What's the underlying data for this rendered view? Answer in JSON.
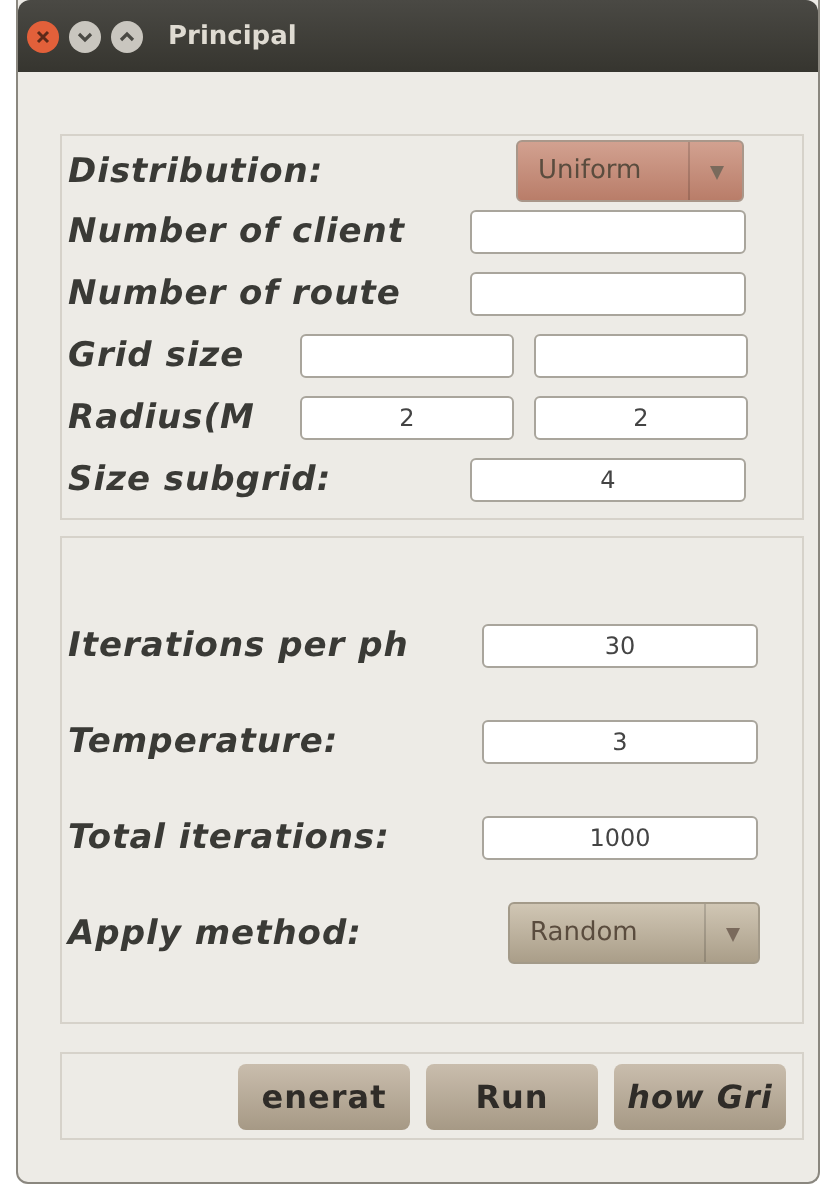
{
  "window": {
    "title": "Principal"
  },
  "settings": [
    {
      "kind": "dropdown",
      "label": "Distribution:",
      "value": "Uniform"
    },
    {
      "kind": "single",
      "label": "Number of client"
    },
    {
      "kind": "single",
      "label": "Number of route"
    },
    {
      "kind": "pair",
      "label": "Grid size"
    },
    {
      "kind": "pair",
      "label": "Radius(M",
      "values": [
        "2",
        "2"
      ]
    },
    {
      "kind": "single",
      "label": "Size subgrid:",
      "value": "4"
    }
  ],
  "method": [
    {
      "kind": "single",
      "label": "Iterations per ph",
      "value": "30"
    },
    {
      "kind": "single",
      "label": "Temperature:",
      "value": "3"
    },
    {
      "kind": "single",
      "label": "Total iterations:",
      "value": "1000"
    },
    {
      "kind": "dropdown",
      "label": "Apply method:",
      "value": "Random"
    }
  ],
  "buttons": [
    {
      "label": "enerat",
      "italic": false
    },
    {
      "label": "Run",
      "italic": false
    },
    {
      "label": "how Gri",
      "italic": true
    }
  ]
}
